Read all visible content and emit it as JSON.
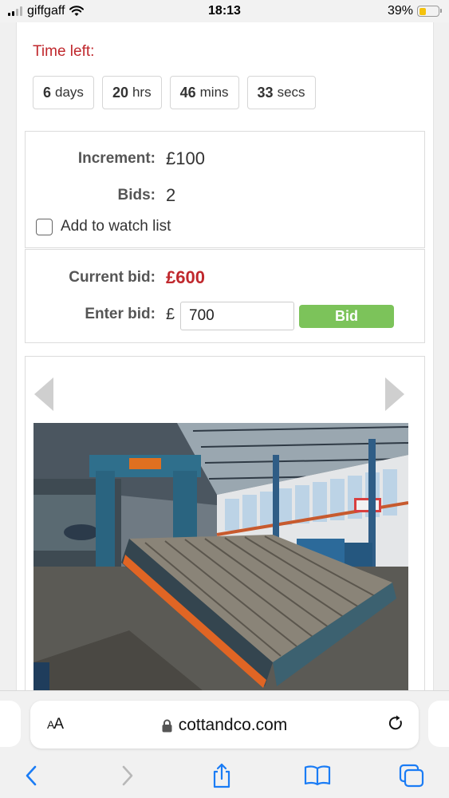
{
  "status_bar": {
    "carrier": "giffgaff",
    "time": "18:13",
    "battery_percent": "39%",
    "battery_level": 0.39
  },
  "countdown": {
    "label": "Time left:",
    "days_value": "6",
    "days_unit": "days",
    "hours_value": "20",
    "hours_unit": "hrs",
    "mins_value": "46",
    "mins_unit": "mins",
    "secs_value": "33",
    "secs_unit": "secs"
  },
  "info": {
    "increment_label": "Increment:",
    "increment_value": "£100",
    "bids_label": "Bids:",
    "bids_value": "2",
    "watch_label": "Add to watch list"
  },
  "bid": {
    "current_label": "Current bid:",
    "current_value": "£600",
    "enter_label": "Enter bid:",
    "currency_symbol": "£",
    "input_value": "700",
    "button_label": "Bid"
  },
  "gallery": {
    "photo_icon": "machine-photo",
    "prev_icon": "chevron-left-icon",
    "next_icon": "chevron-right-icon"
  },
  "browser": {
    "text_size_label_big": "A",
    "text_size_label_small": "A",
    "url": "cottandco.com"
  },
  "colors": {
    "accent_red": "#c0282d",
    "bid_button": "#7cc35a",
    "safari_blue": "#1a7cf5"
  }
}
